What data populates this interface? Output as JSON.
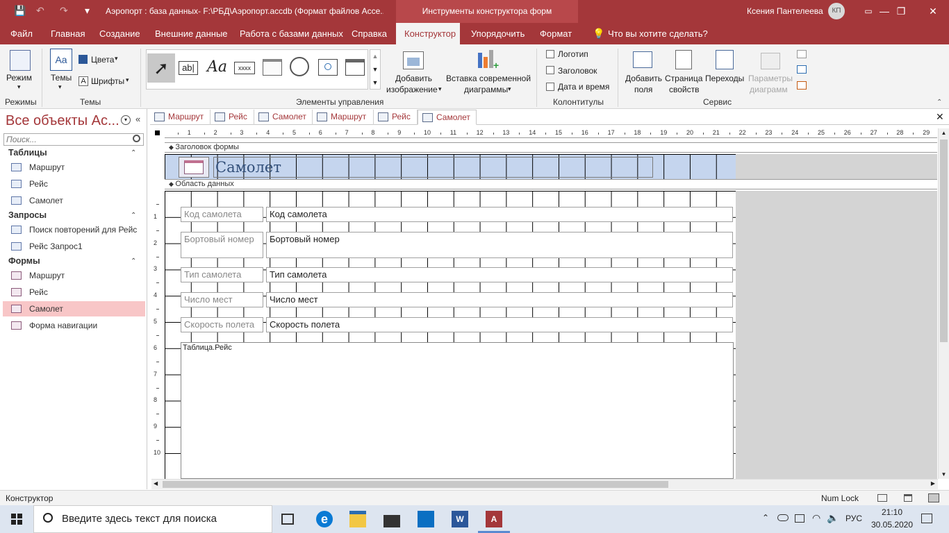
{
  "window": {
    "title": "Аэропорт : база данных- F:\\РБД\\Аэропорт.accdb (Формат файлов Acce...",
    "context_tab": "Инструменты конструктора форм",
    "user": "Ксения Пантелеева",
    "avatar": "КП",
    "minimize": "—",
    "restore": "❐",
    "close": "✕"
  },
  "qat": {
    "save": "💾",
    "undo": "↶",
    "redo": "↷",
    "more": "▾"
  },
  "menu": {
    "tabs": [
      "Файл",
      "Главная",
      "Создание",
      "Внешние данные",
      "Работа с базами данных",
      "Справка",
      "Конструктор",
      "Упорядочить",
      "Формат"
    ],
    "active": "Конструктор",
    "tell_me": "Что вы хотите сделать?"
  },
  "ribbon": {
    "mode": "Режим",
    "themes": "Темы",
    "colors": "Цвета",
    "fonts": "Шрифты",
    "group_modes": "Режимы",
    "group_themes": "Темы",
    "group_controls": "Элементы управления",
    "add_image_1": "Добавить",
    "add_image_2": "изображение",
    "insert_chart_1": "Вставка современной",
    "insert_chart_2": "диаграммы",
    "logo": "Логотип",
    "header": "Заголовок",
    "datetime": "Дата и время",
    "group_headers": "Колонтитулы",
    "add_fields_1": "Добавить",
    "add_fields_2": "поля",
    "props_1": "Страница",
    "props_2": "свойств",
    "transitions": "Переходы",
    "chart_params_1": "Параметры",
    "chart_params_2": "диаграмм",
    "group_service": "Сервис",
    "textbox_icon": "ab|",
    "label_icon": "Aa",
    "xxxx": "xxxx"
  },
  "nav": {
    "title": "Все объекты Ac...",
    "search_placeholder": "Поиск...",
    "cat_tables": "Таблицы",
    "cat_queries": "Запросы",
    "cat_forms": "Формы",
    "tables": [
      "Маршрут",
      "Рейс",
      "Самолет"
    ],
    "queries": [
      "Поиск повторений для Рейс",
      "Рейс Запрос1"
    ],
    "forms": [
      "Маршрут",
      "Рейс",
      "Самолет",
      "Форма навигации"
    ],
    "selected": "Самолет"
  },
  "doctabs": [
    "Маршрут",
    "Рейс",
    "Самолет",
    "Маршрут",
    "Рейс",
    "Самолет"
  ],
  "form": {
    "header_section": "Заголовок формы",
    "detail_section": "Область данных",
    "title": "Самолет",
    "fields": [
      {
        "label": "Код самолета",
        "control": "Код самолета"
      },
      {
        "label": "Бортовый номер",
        "control": "Бортовый номер"
      },
      {
        "label": "Тип самолета",
        "control": "Тип самолета"
      },
      {
        "label": "Число мест",
        "control": "Число мест"
      },
      {
        "label": "Скорость полета",
        "control": "Скорость полета"
      }
    ],
    "subform": "Таблица.Рейс"
  },
  "ruler": {
    "h": [
      "1",
      "2",
      "3",
      "4",
      "5",
      "6",
      "7",
      "8",
      "9",
      "10",
      "11",
      "12",
      "13",
      "14",
      "15",
      "16",
      "17",
      "18",
      "19",
      "20",
      "21",
      "22",
      "23",
      "24",
      "25",
      "26",
      "27",
      "28",
      "29"
    ],
    "v": [
      "1",
      "2",
      "3",
      "4",
      "5",
      "6",
      "7",
      "8",
      "9",
      "10"
    ]
  },
  "status": {
    "mode": "Конструктор",
    "numlock": "Num Lock"
  },
  "taskbar": {
    "search": "Введите здесь текст для поиска",
    "time": "21:10",
    "date": "30.05.2020",
    "lang": "РУС"
  }
}
